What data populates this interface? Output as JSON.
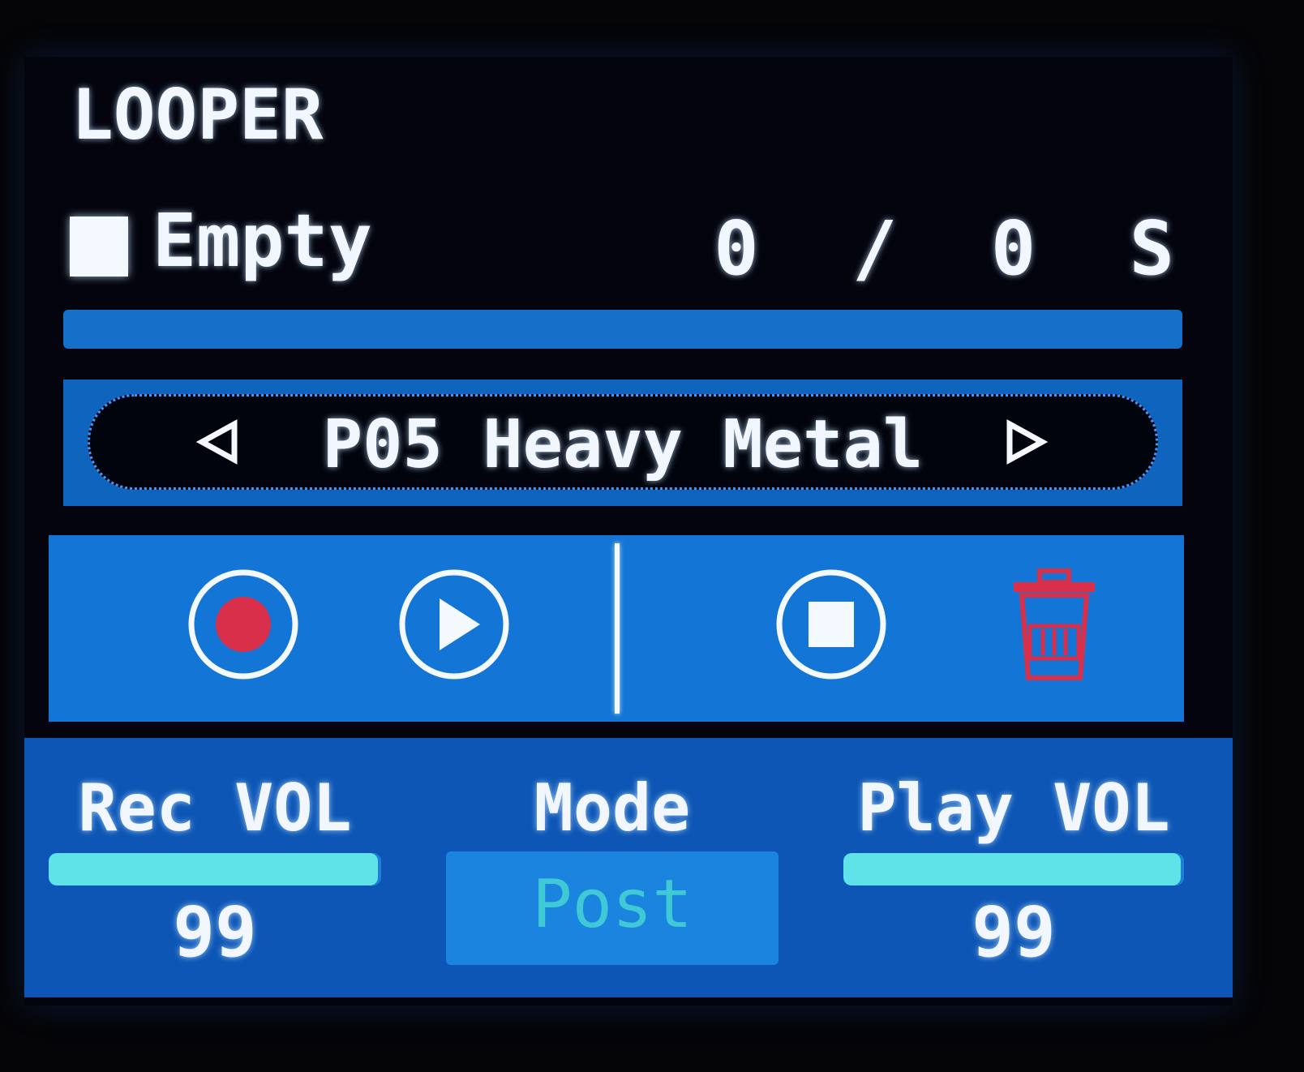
{
  "app": {
    "title": "LOOPER"
  },
  "status": {
    "state_label": "Empty",
    "counter": "0 / 0 S",
    "progress": 0
  },
  "preset": {
    "name": "P05 Heavy Metal",
    "prev_icon": "triangle-left-icon",
    "next_icon": "triangle-right-icon"
  },
  "transport": {
    "record_icon": "record-icon",
    "play_icon": "play-icon",
    "stop_icon": "stop-icon",
    "delete_icon": "trash-icon",
    "record_color": "#d8304a",
    "delete_color": "#d8304a"
  },
  "params": {
    "rec_vol": {
      "label": "Rec VOL",
      "value": "99",
      "level": 0.99
    },
    "mode": {
      "label": "Mode",
      "value": "Post"
    },
    "play_vol": {
      "label": "Play VOL",
      "value": "99",
      "level": 0.99
    }
  },
  "colors": {
    "panel_blue": "#1376d6",
    "accent_cyan": "#5fe3e8",
    "text": "#f2f7ff"
  }
}
